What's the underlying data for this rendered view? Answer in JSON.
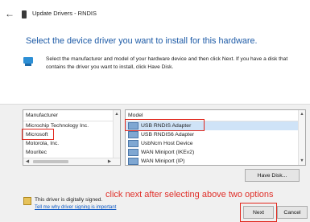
{
  "window": {
    "back_icon": "←",
    "title": "Update Drivers - RNDIS"
  },
  "main": {
    "heading": "Select the device driver you want to install for this hardware.",
    "info_text": "Select the manufacturer and model of your hardware device and then click Next. If you have a disk that contains the driver you want to install, click Have Disk."
  },
  "manufacturer_list": {
    "header": "Manufacturer",
    "items": [
      "Microchip Technology Inc.",
      "Microsoft",
      "Motorola, Inc.",
      "Mouritec"
    ],
    "selected": "Microsoft"
  },
  "model_list": {
    "header": "Model",
    "items": [
      "USB RNDIS Adapter",
      "USB RNDIS6 Adapter",
      "UsbNcm Host Device",
      "WAN Miniport (IKEv2)",
      "WAN Miniport (IP)"
    ],
    "selected": "USB RNDIS Adapter"
  },
  "signed_text": "This driver is digitally signed.",
  "signing_link": "Tell me why driver signing is important",
  "buttons": {
    "have_disk": "Have Disk...",
    "next": "Next",
    "cancel": "Cancel"
  },
  "annotation": "click next after selecting above two options",
  "colors": {
    "heading": "#1c5aa6",
    "annotation": "#e0302a",
    "link": "#0a56c2"
  }
}
